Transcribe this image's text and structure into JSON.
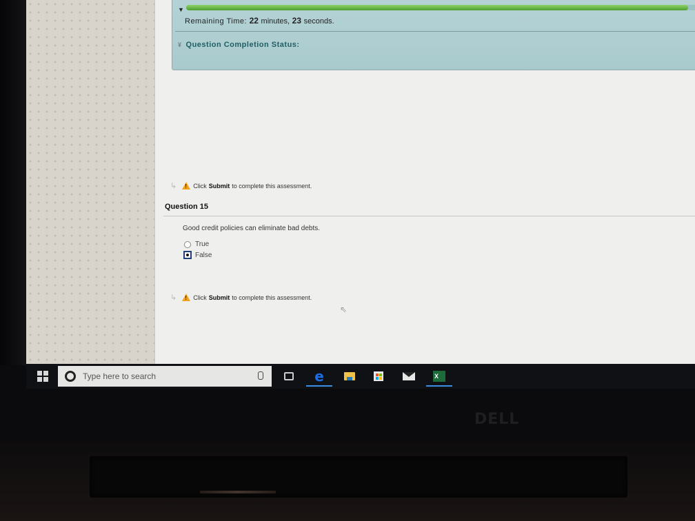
{
  "exam": {
    "timer": {
      "label": "Remaining Time:",
      "minutes_value": "22",
      "minutes_unit": "minutes,",
      "seconds_value": "23",
      "seconds_unit": "seconds.",
      "progress_fraction": 0.97,
      "toggle_icon": "caret-down-icon"
    },
    "completion_status": {
      "label": "Question Completion Status:",
      "chevron_icon": "double-chevron-down-icon"
    },
    "submit_notice_top": {
      "prefix": "Click",
      "bold": "Submit",
      "suffix": "to complete this assessment."
    },
    "question": {
      "title": "Question 15",
      "text": "Good credit policies can eliminate bad debts.",
      "options": [
        {
          "label": "True",
          "selected": false
        },
        {
          "label": "False",
          "selected": true
        }
      ]
    },
    "submit_notice_bottom": {
      "prefix": "Click",
      "bold": "Submit",
      "suffix": "to complete this assessment."
    }
  },
  "taskbar": {
    "search_placeholder": "Type here to search",
    "apps": [
      {
        "name": "Task View",
        "icon": "task-view-icon",
        "active": false
      },
      {
        "name": "Microsoft Edge",
        "icon": "edge-icon",
        "active": true
      },
      {
        "name": "File Explorer",
        "icon": "folder-icon",
        "active": false
      },
      {
        "name": "Microsoft Store",
        "icon": "store-icon",
        "active": false
      },
      {
        "name": "Mail",
        "icon": "mail-icon",
        "active": false
      },
      {
        "name": "Excel",
        "icon": "excel-icon",
        "active": true
      }
    ]
  },
  "hardware": {
    "brand": "DELL"
  },
  "colors": {
    "progress_green": "#5fae3a",
    "panel_teal": "#aecdd0",
    "status_text": "#1f5e63",
    "warning_orange": "#f2a21b",
    "taskbar_accent": "#3a8ee6"
  }
}
